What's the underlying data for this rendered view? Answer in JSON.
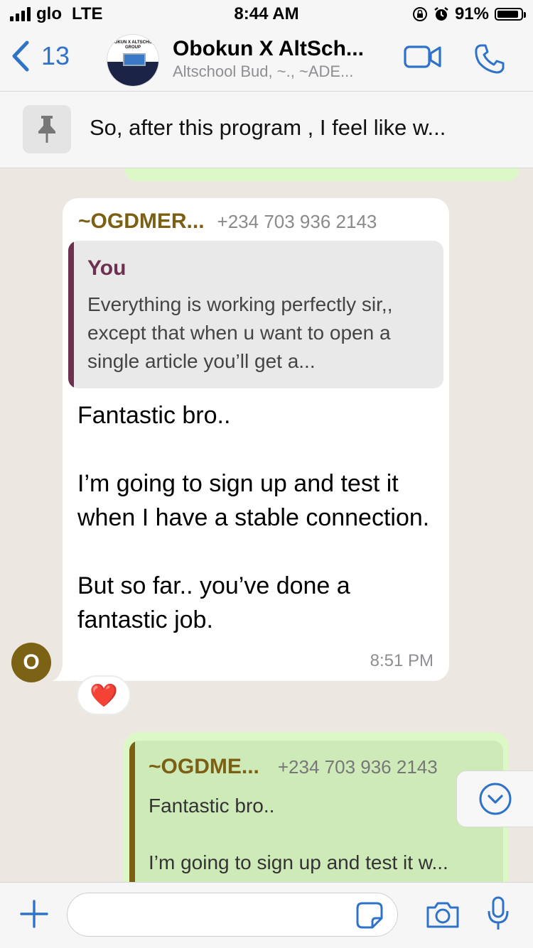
{
  "status_bar": {
    "carrier": "glo",
    "network": "LTE",
    "time": "8:44 AM",
    "battery": "91%",
    "battery_level": 0.91
  },
  "header": {
    "back_count": "13",
    "title": "Obokun X AltSch...",
    "subtitle": "Altschool Bud, ~., ~ADE...",
    "avatar_text": "OBOKUN X ALTSCHOOL GROUP"
  },
  "pinned": {
    "text": "So, after this program , I feel like w..."
  },
  "messages": {
    "incoming": {
      "sender_name": "~OGDMER...",
      "sender_phone": "+234 703 936 2143",
      "avatar_letter": "O",
      "quote_author": "You",
      "quote_text": "Everything is working perfectly sir,, except that when u want to open a single article you’ll get a...",
      "body": "Fantastic bro..\n\nI’m going to sign up and test it when I have a stable connection.\n\nBut so far.. you’ve done a fantastic job.",
      "time": "8:51 PM",
      "reaction": "❤️"
    },
    "outgoing": {
      "quote_name": "~OGDME...",
      "quote_phone": "+234 703 936 2143",
      "quote_text": "Fantastic bro..\n\nI’m going to sign up and test it w..."
    }
  },
  "input": {
    "placeholder": ""
  },
  "colors": {
    "accent": "#2f73c9",
    "outgoing_bubble": "#dcf8c6",
    "sender_name": "#7b5f12",
    "quote_bar_you": "#6e3050"
  }
}
